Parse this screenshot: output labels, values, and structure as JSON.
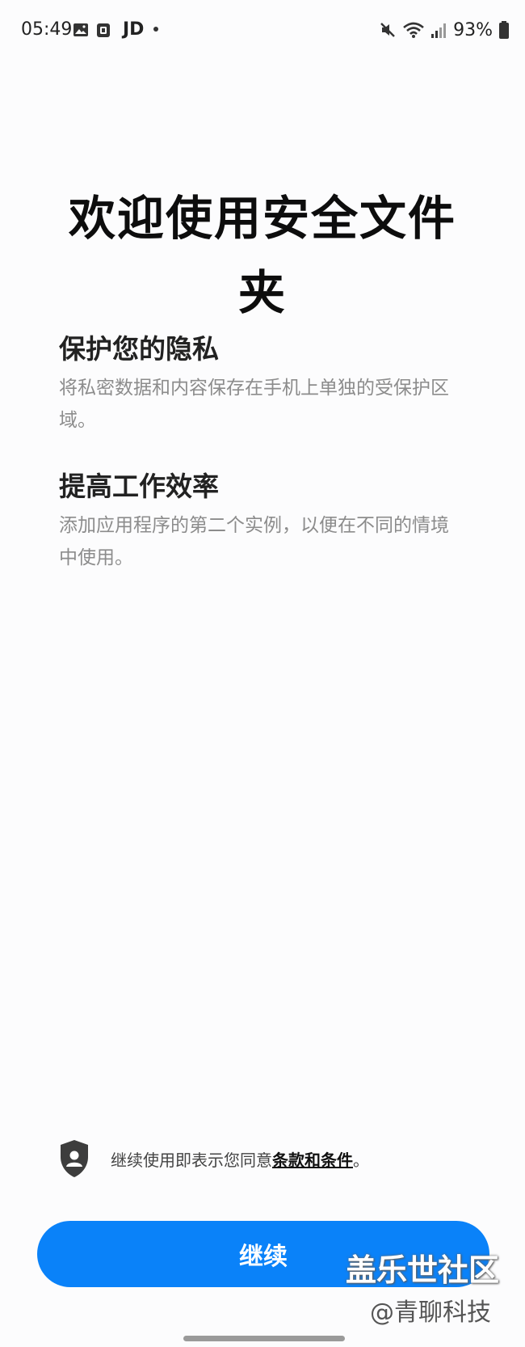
{
  "status_bar": {
    "time": "05:49",
    "carrier_text": "JD",
    "battery": "93%",
    "icons": [
      "gallery-icon",
      "notification-icon",
      "mute-icon",
      "wifi-icon",
      "signal-icon",
      "battery-icon"
    ]
  },
  "welcome": {
    "title": "欢迎使用安全文件夹"
  },
  "features": [
    {
      "title": "保护您的隐私",
      "description": "将私密数据和内容保存在手机上单独的受保护区域。"
    },
    {
      "title": "提高工作效率",
      "description": "添加应用程序的第二个实例，以便在不同的情境中使用。"
    }
  ],
  "terms": {
    "prefix": "继续使用即表示您同意",
    "link": "条款和条件",
    "suffix": "。"
  },
  "continue_label": "继续",
  "watermark": {
    "line1": "盖乐世社区",
    "line2": "@青聊科技"
  },
  "colors": {
    "accent": "#0a82f9",
    "background": "#fcfcfd",
    "secondary_text": "#8c8c8c"
  }
}
